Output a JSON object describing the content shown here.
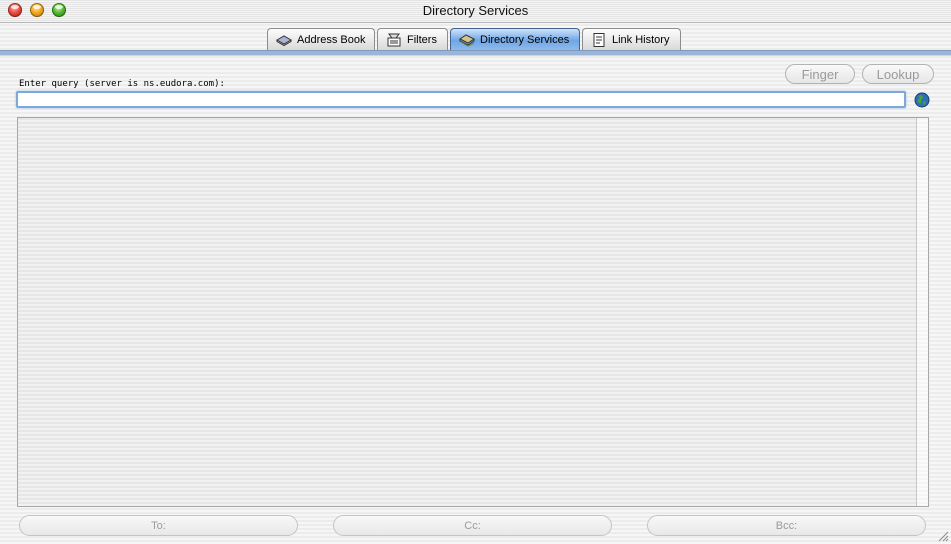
{
  "window": {
    "title": "Directory Services",
    "controls": {
      "close": "close-button",
      "minimize": "minimize-button",
      "zoom": "zoom-button"
    }
  },
  "tabs": [
    {
      "label": "Address Book",
      "icon": "address-book-icon",
      "active": false
    },
    {
      "label": "Filters",
      "icon": "filters-icon",
      "active": false
    },
    {
      "label": "Directory Services",
      "icon": "directory-services-icon",
      "active": true
    },
    {
      "label": "Link History",
      "icon": "link-history-icon",
      "active": false
    }
  ],
  "query": {
    "label": "Enter query (server is ns.eudora.com):",
    "value": "",
    "placeholder": "",
    "server_icon": "globe-icon"
  },
  "buttons": {
    "finger": "Finger",
    "lookup": "Lookup",
    "to": "To:",
    "cc": "Cc:",
    "bcc": "Bcc:"
  },
  "colors": {
    "active_tab": "#6fa6e6",
    "focus_ring": "#7fa7d8",
    "disabled_text": "#9a9a9a"
  }
}
